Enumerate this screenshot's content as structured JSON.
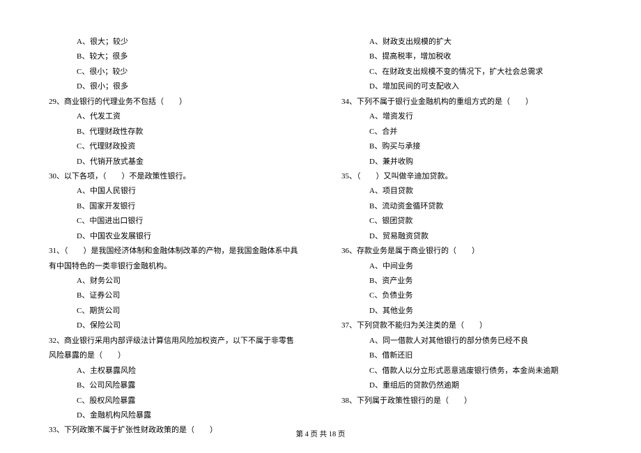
{
  "left": {
    "q28_options": [
      "A、很大；较少",
      "B、较大；很多",
      "C、很小；较少",
      "D、很小；很多"
    ],
    "q29": "29、商业银行的代理业务不包括（　　）",
    "q29_options": [
      "A、代发工资",
      "B、代理财政性存款",
      "C、代理财政投资",
      "D、代销开放式基金"
    ],
    "q30": "30、以下各项，（　　）不是政策性银行。",
    "q30_options": [
      "A、中国人民银行",
      "B、国家开发银行",
      "C、中国进出口银行",
      "D、中国农业发展银行"
    ],
    "q31": "31、（　　）是我国经济体制和金融体制改革的产物，是我国金融体系中具有中国特色的一类非银行金融机构。",
    "q31_options": [
      "A、财务公司",
      "B、证券公司",
      "C、期货公司",
      "D、保险公司"
    ],
    "q32": "32、商业银行采用内部评级法计算信用风险加权资产，以下不属于非零售风险暴露的是（　　）",
    "q32_options": [
      "A、主权暴露风险",
      "B、公司风险暴露",
      "C、股权风险暴露",
      "D、金融机构风险暴露"
    ],
    "q33": "33、下列政策不属于扩张性财政政策的是（　　）"
  },
  "right": {
    "q33_options": [
      "A、财政支出规模的扩大",
      "B、提高税率，增加税收",
      "C、在财政支出规模不变的情况下，扩大社会总需求",
      "D、增加民间的可支配收入"
    ],
    "q34": "34、下列不属于银行业金融机构的重组方式的是（　　）",
    "q34_options": [
      "A、增资发行",
      "C、合并",
      "B、购买与承接",
      "D、兼并收购"
    ],
    "q35": "35、（　　）又叫做辛迪加贷款。",
    "q35_options": [
      "A、项目贷款",
      "B、流动资金循环贷款",
      "C、银团贷款",
      "D、贸易融资贷款"
    ],
    "q36": "36、存款业务是属于商业银行的（　　）",
    "q36_options": [
      "A、中间业务",
      "B、资产业务",
      "C、负债业务",
      "D、其他业务"
    ],
    "q37": "37、下列贷款不能归为关注类的是（　　）",
    "q37_options": [
      "A、同一借款人对其他银行的部分债务已经不良",
      "B、借新还旧",
      "C、借款人以分立形式恶意逃废银行债务，本金尚未逾期",
      "D、重组后的贷款仍然逾期"
    ],
    "q38": "38、下列属于政策性银行的是（　　）"
  },
  "footer": "第 4 页 共 18 页"
}
